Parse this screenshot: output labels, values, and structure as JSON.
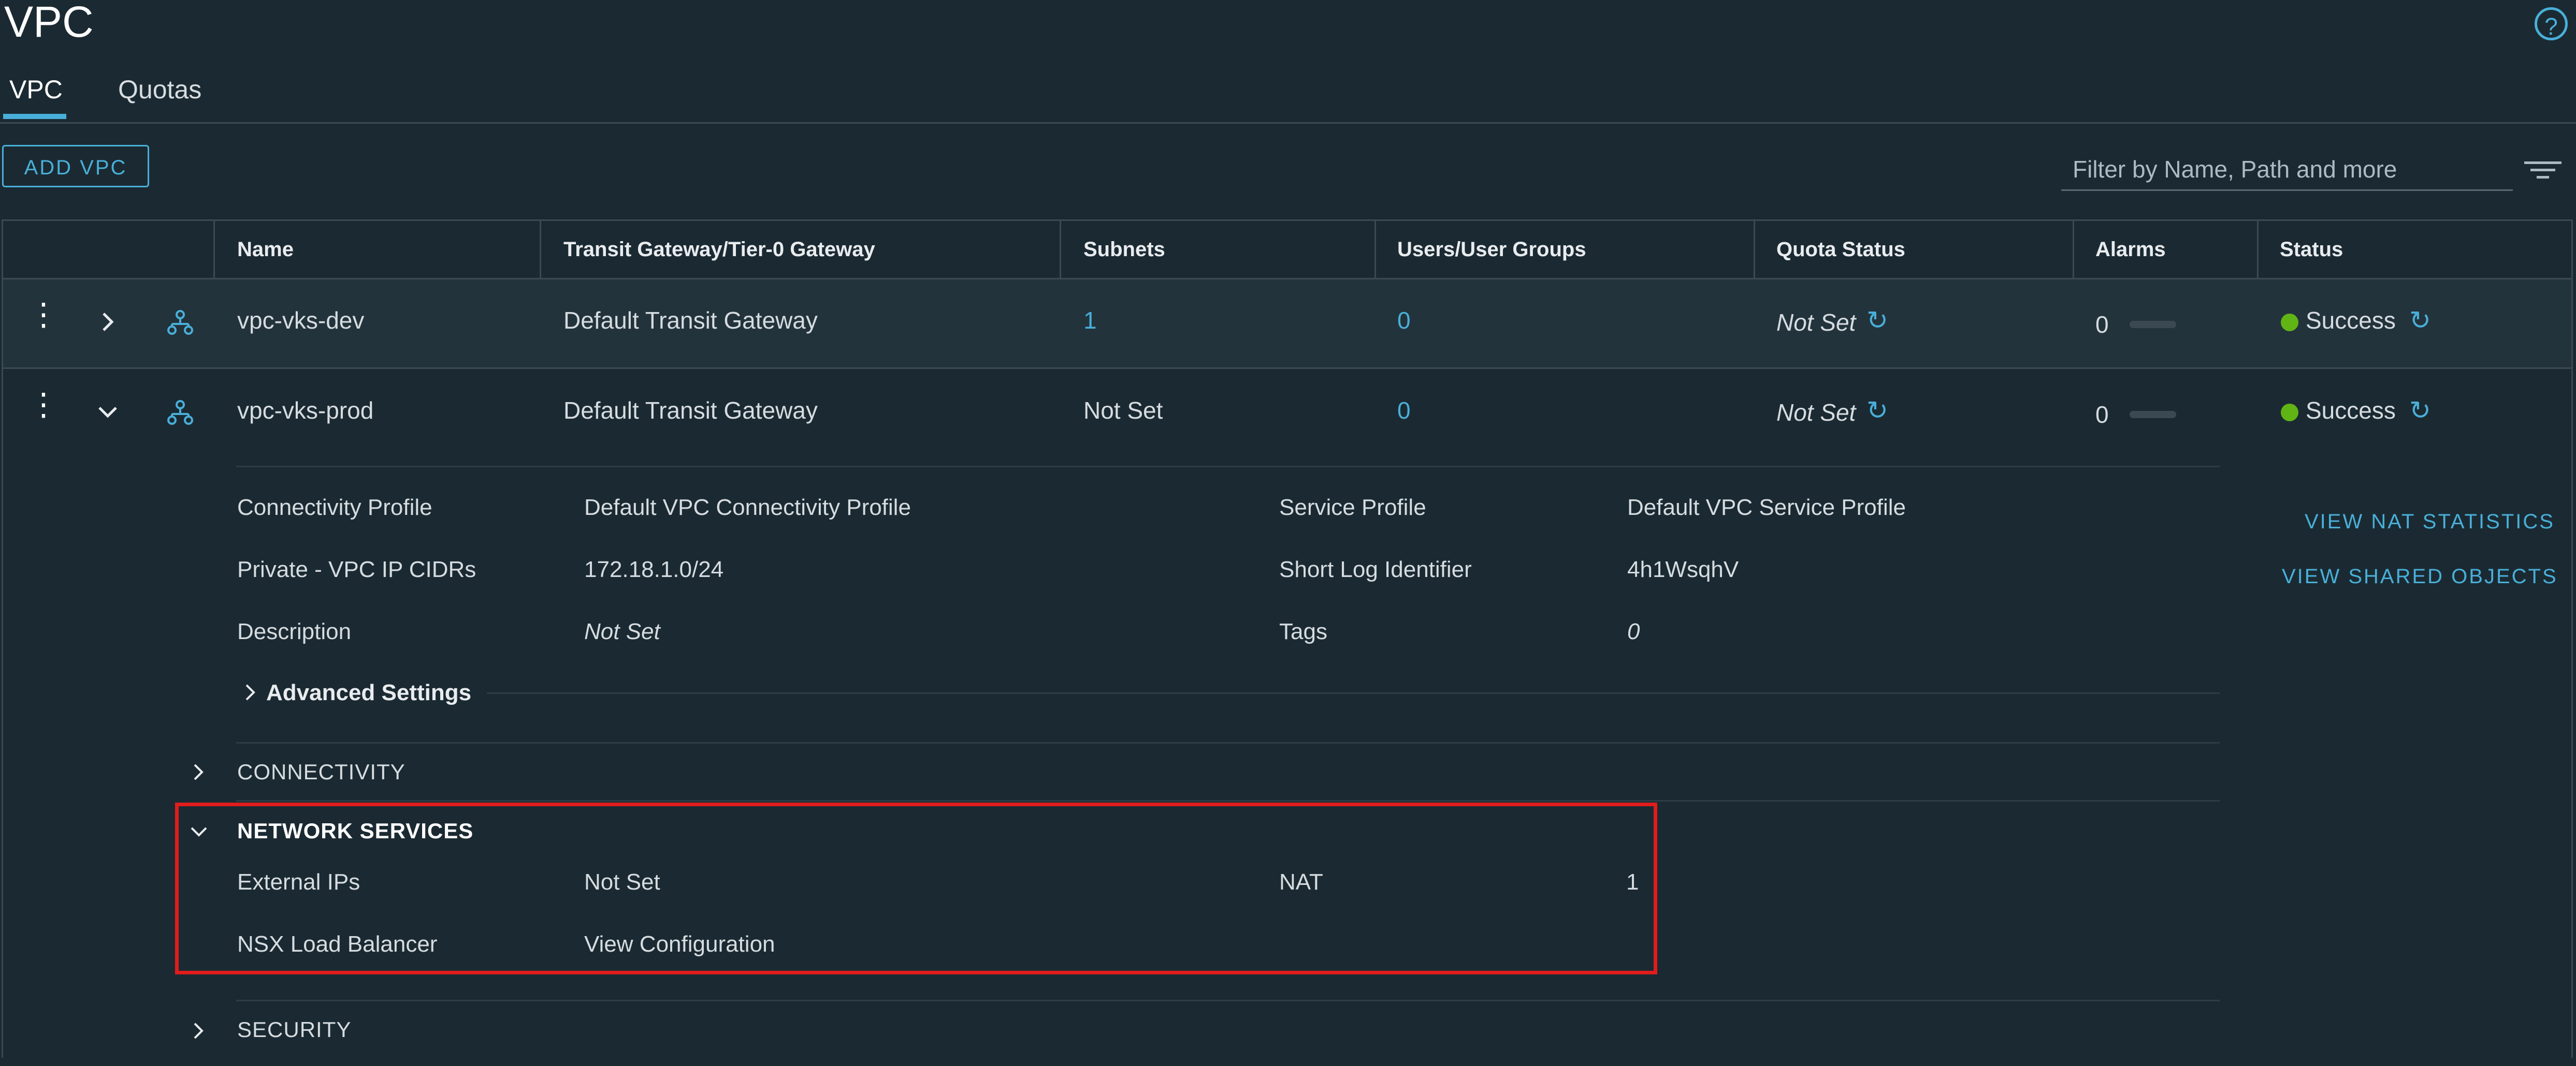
{
  "page": {
    "title": "VPC"
  },
  "tabs": [
    {
      "label": "VPC",
      "active": true
    },
    {
      "label": "Quotas",
      "active": false
    }
  ],
  "toolbar": {
    "add_label": "ADD VPC",
    "filter_placeholder": "Filter by Name, Path and more"
  },
  "table": {
    "columns": [
      "Name",
      "Transit Gateway/Tier-0 Gateway",
      "Subnets",
      "Users/User Groups",
      "Quota Status",
      "Alarms",
      "Status"
    ],
    "rows": [
      {
        "name": "vpc-vks-dev",
        "gateway": "Default Transit Gateway",
        "subnets": "1",
        "users": "0",
        "quota": "Not Set",
        "alarms": "0",
        "status": "Success",
        "expanded": false
      },
      {
        "name": "vpc-vks-prod",
        "gateway": "Default Transit Gateway",
        "subnets": "Not Set",
        "users": "0",
        "quota": "Not Set",
        "alarms": "0",
        "status": "Success",
        "expanded": true
      }
    ]
  },
  "details": {
    "connectivity_profile_label": "Connectivity Profile",
    "connectivity_profile_value": "Default VPC Connectivity Profile",
    "private_cidrs_label": "Private - VPC IP CIDRs",
    "private_cidrs_value": "172.18.1.0/24",
    "description_label": "Description",
    "description_value": "Not Set",
    "service_profile_label": "Service Profile",
    "service_profile_value": "Default VPC Service Profile",
    "short_log_label": "Short Log Identifier",
    "short_log_value": "4h1WsqhV",
    "tags_label": "Tags",
    "tags_value": "0",
    "advanced_label": "Advanced Settings",
    "view_nat_label": "VIEW NAT STATISTICS",
    "view_shared_label": "VIEW SHARED OBJECTS"
  },
  "sections": {
    "connectivity": "CONNECTIVITY",
    "network_services": "NETWORK SERVICES",
    "security": "SECURITY"
  },
  "network_services": {
    "external_ips_label": "External IPs",
    "external_ips_value": "Not Set",
    "nat_label": "NAT",
    "nat_value": "1",
    "lb_label": "NSX Load Balancer",
    "lb_value": "View Configuration"
  },
  "colors": {
    "accent": "#49afd9",
    "success": "#60b515",
    "highlight": "#e01c1c",
    "background": "#1b2a32"
  }
}
